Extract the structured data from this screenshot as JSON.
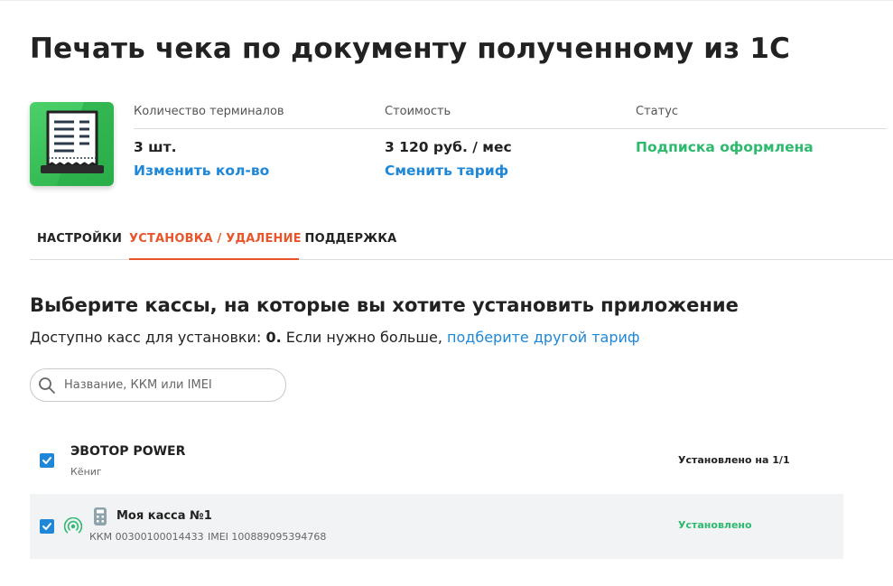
{
  "page": {
    "title": "Печать чека по документу полученному из 1С"
  },
  "app_info": {
    "icon": "receipt-icon",
    "terminals_label": "Количество терминалов",
    "terminals_value": "3 шт.",
    "terminals_link": "Изменить кол-во",
    "cost_label": "Стоимость",
    "cost_value": "3 120 руб. / мес",
    "cost_link": "Сменить тариф",
    "status_label": "Статус",
    "status_value": "Подписка оформлена"
  },
  "tabs": [
    {
      "label": "НАСТРОЙКИ",
      "active": false
    },
    {
      "label": "УСТАНОВКА / УДАЛЕНИЕ",
      "active": true
    },
    {
      "label": "ПОДДЕРЖКА",
      "active": false
    }
  ],
  "install": {
    "heading": "Выберите кассы, на которые вы хотите установить приложение",
    "available_prefix": "Доступно касс для установки: ",
    "available_count": "0.",
    "available_suffix": " Если нужно больше, ",
    "available_link": "подберите другой тариф",
    "search_placeholder": "Название, ККМ или IMEI"
  },
  "groups": [
    {
      "name": "ЭВОТОР POWER",
      "subtitle": "Кёниг",
      "checked": true,
      "status": "Установлено на 1/1",
      "devices": [
        {
          "name": "Моя касса №1",
          "kkm": "ККМ 00300100014433",
          "imei": "IMEI 100889095394768",
          "status": "Установлено",
          "checked": true
        }
      ]
    }
  ],
  "colors": {
    "accent": "#e9552b",
    "link": "#1e87d8",
    "success": "#2dba6e",
    "icon_bg": "#33bb52"
  }
}
